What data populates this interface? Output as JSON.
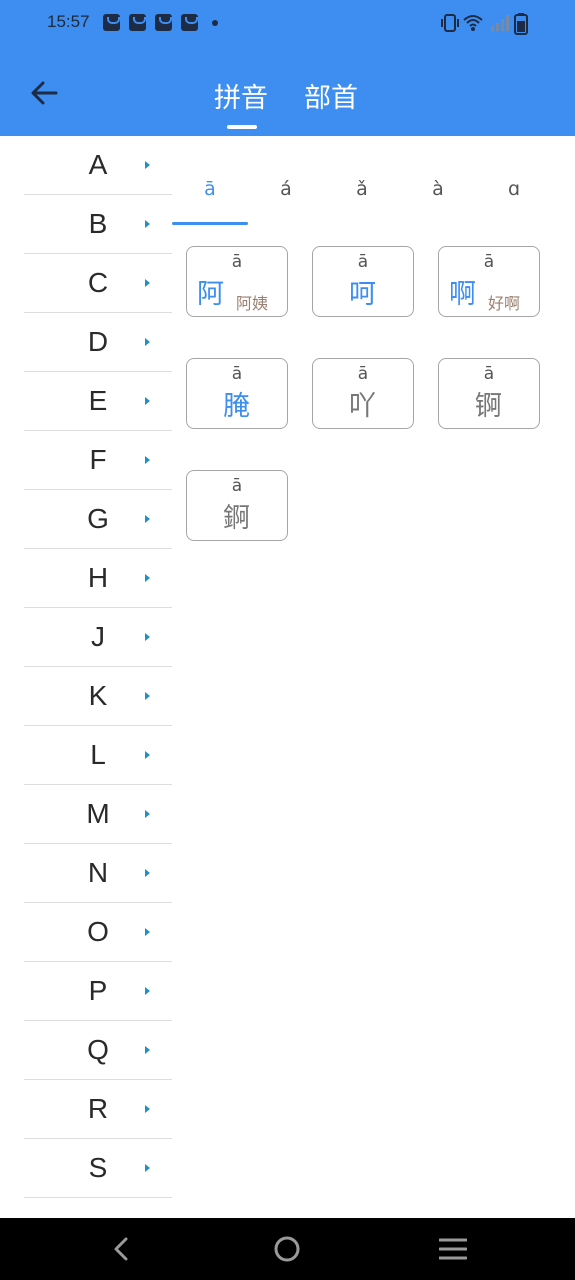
{
  "status_bar": {
    "time": "15:57",
    "notification_icons": [
      "bag-icon",
      "bag-icon",
      "bag-icon",
      "bag-icon"
    ],
    "right_icons": [
      "vibrate-icon",
      "wifi-icon",
      "signal-icon",
      "battery-icon"
    ]
  },
  "header": {
    "back_icon": "arrow-left-icon",
    "tabs": [
      {
        "label": "拼音",
        "active": true
      },
      {
        "label": "部首",
        "active": false
      }
    ]
  },
  "letters": [
    "A",
    "B",
    "C",
    "D",
    "E",
    "F",
    "G",
    "H",
    "J",
    "K",
    "L",
    "M",
    "N",
    "O",
    "P",
    "Q",
    "R",
    "S"
  ],
  "tones": [
    {
      "label": "ā",
      "active": true
    },
    {
      "label": "á",
      "active": false
    },
    {
      "label": "ǎ",
      "active": false
    },
    {
      "label": "à",
      "active": false
    },
    {
      "label": "ɑ",
      "active": false
    }
  ],
  "characters": [
    {
      "pinyin": "ā",
      "char": "阿",
      "word": "阿姨",
      "color": "#3d8ef0"
    },
    {
      "pinyin": "ā",
      "char": "呵",
      "word": "",
      "color": "#3d8ef0"
    },
    {
      "pinyin": "ā",
      "char": "啊",
      "word": "好啊",
      "color": "#3d8ef0"
    },
    {
      "pinyin": "ā",
      "char": "腌",
      "word": "",
      "color": "#3d8ef0"
    },
    {
      "pinyin": "ā",
      "char": "吖",
      "word": "",
      "color": "#777777"
    },
    {
      "pinyin": "ā",
      "char": "锕",
      "word": "",
      "color": "#777777"
    },
    {
      "pinyin": "ā",
      "char": "錒",
      "word": "",
      "color": "#777777"
    }
  ],
  "nav_bar": {
    "icons": [
      "nav-back-icon",
      "home-icon",
      "menu-icon"
    ]
  },
  "colors": {
    "primary": "#3d8ef0",
    "caret": "#1f8fc4",
    "word": "#9a8070"
  }
}
